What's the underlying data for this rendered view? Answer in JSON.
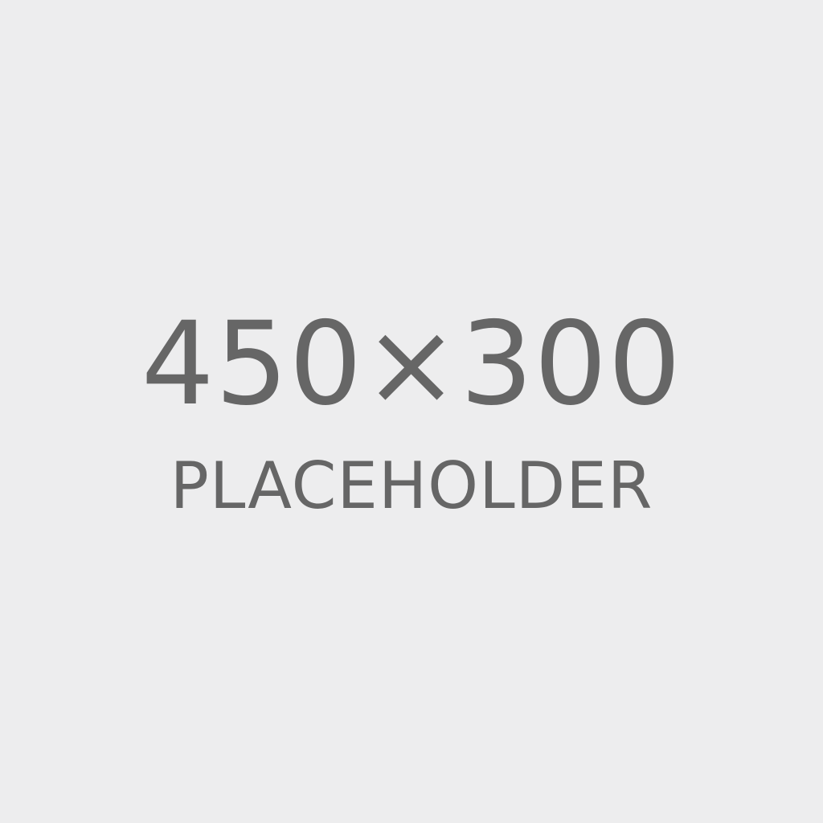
{
  "placeholder": {
    "dimensions": "450×300",
    "label": "PLACEHOLDER",
    "colors": {
      "background": "#ededee",
      "text": "#666666"
    }
  }
}
